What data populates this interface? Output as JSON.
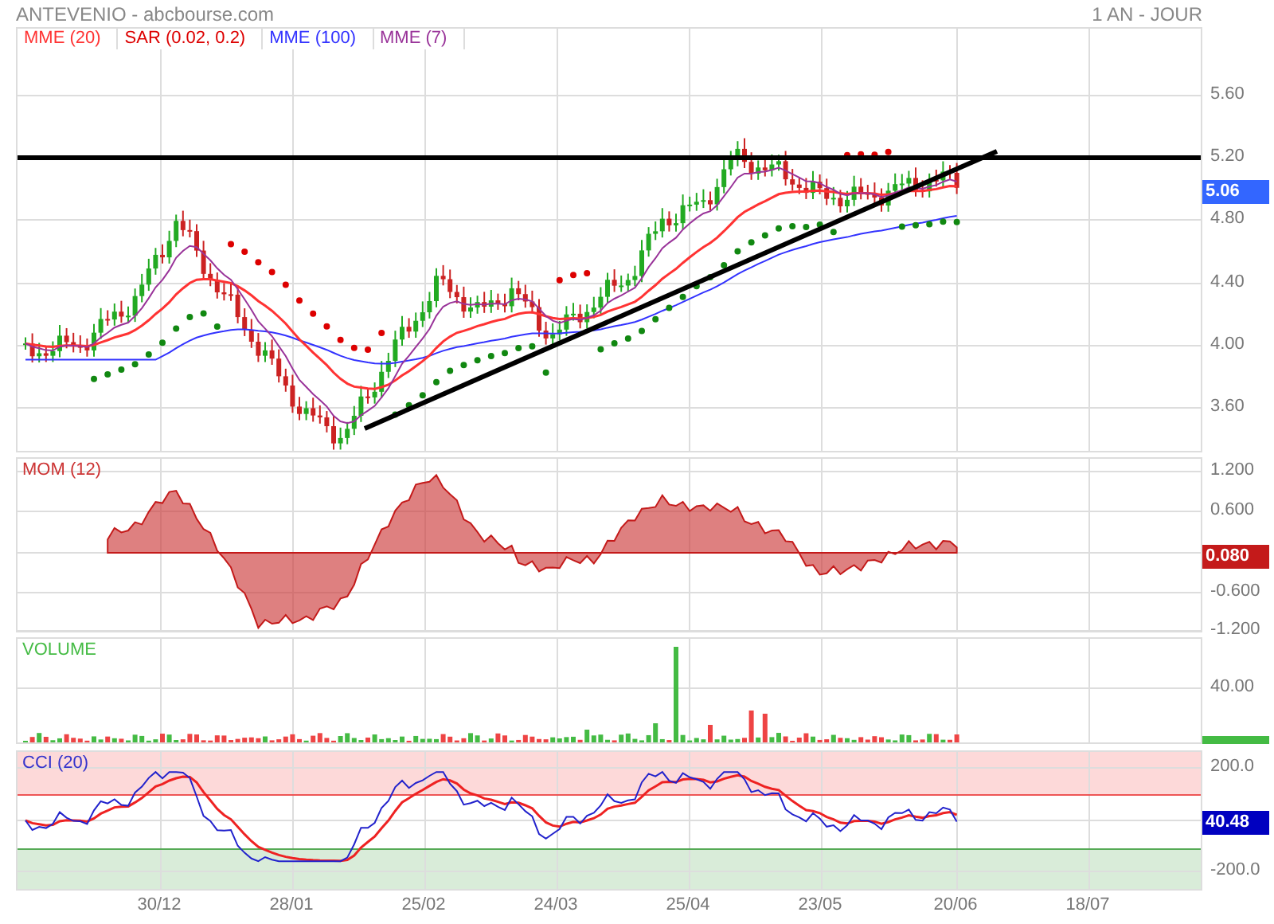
{
  "title": "ANTEVENIO - abcbourse.com",
  "period": "1 AN - JOUR",
  "legend": [
    {
      "label": "MME (20)",
      "color": "#ff3333"
    },
    {
      "label": "SAR (0.02, 0.2)",
      "color": "#dd0000"
    },
    {
      "label": "MME (100)",
      "color": "#3333ff"
    },
    {
      "label": "MME (7)",
      "color": "#993399"
    }
  ],
  "panels": [
    {
      "kind": "price",
      "yticks": [
        "5.60",
        "5.20",
        "4.80",
        "4.40",
        "4.00",
        "3.60"
      ],
      "last": {
        "text": "5.06",
        "color": "#3366ff"
      }
    },
    {
      "kind": "momentum",
      "label": "MOM (12)",
      "yticks": [
        "1.200",
        "0.600",
        "-0.600",
        "-1.200"
      ],
      "last": {
        "text": "0.080",
        "color": "#c41a1a"
      }
    },
    {
      "kind": "volume",
      "label": "VOLUME",
      "yticks": [
        "40.00"
      ],
      "last": {
        "color": "#44bb44"
      }
    },
    {
      "kind": "cci",
      "label": "CCI (20)",
      "yticks": [
        "200.0",
        "-200.0"
      ],
      "last": {
        "text": "40.48",
        "color": "#0000c0"
      }
    }
  ],
  "xticks": [
    "30/12",
    "28/01",
    "25/02",
    "24/03",
    "25/04",
    "23/05",
    "20/06",
    "18/07"
  ]
}
